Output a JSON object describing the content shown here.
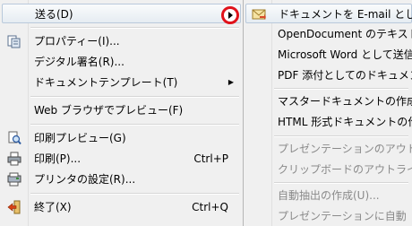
{
  "menu": {
    "send": "送る(D)",
    "properties": "プロパティー(I)...",
    "digital_signature": "デジタル署名(R)...",
    "templates": "ドキュメントテンプレート(T)",
    "web_preview": "Web ブラウザでプレビュー(F)",
    "print_preview": "印刷プレビュー(G)",
    "print": "印刷(P)...",
    "print_shortcut": "Ctrl+P",
    "printer_settings": "プリンタの設定(R)...",
    "exit": "終了(X)",
    "exit_shortcut": "Ctrl+Q"
  },
  "submenu": {
    "email": "ドキュメントを E-mail とし",
    "opendocument": "OpenDocument のテキスト",
    "msword": "Microsoft Word として送信",
    "pdf": "PDF 添付としてのドキュメン",
    "master": "マスタードキュメントの作成",
    "html": "HTML 形式ドキュメントの作",
    "pres_outline": "プレゼンテーションのアウト",
    "clipboard_outline": "クリップボードのアウトライ",
    "autoabstract": "自動抽出の作成(U)...",
    "pres_autoabstract": "プレゼンテーションに自動"
  },
  "colors": {
    "highlight_border": "#b9c9db",
    "annotation_circle": "#e0121a",
    "disabled_text": "#8a8a8a"
  },
  "icons": [
    "properties-icon",
    "print-preview-icon",
    "print-icon",
    "printer-settings-icon",
    "exit-icon",
    "email-icon"
  ]
}
